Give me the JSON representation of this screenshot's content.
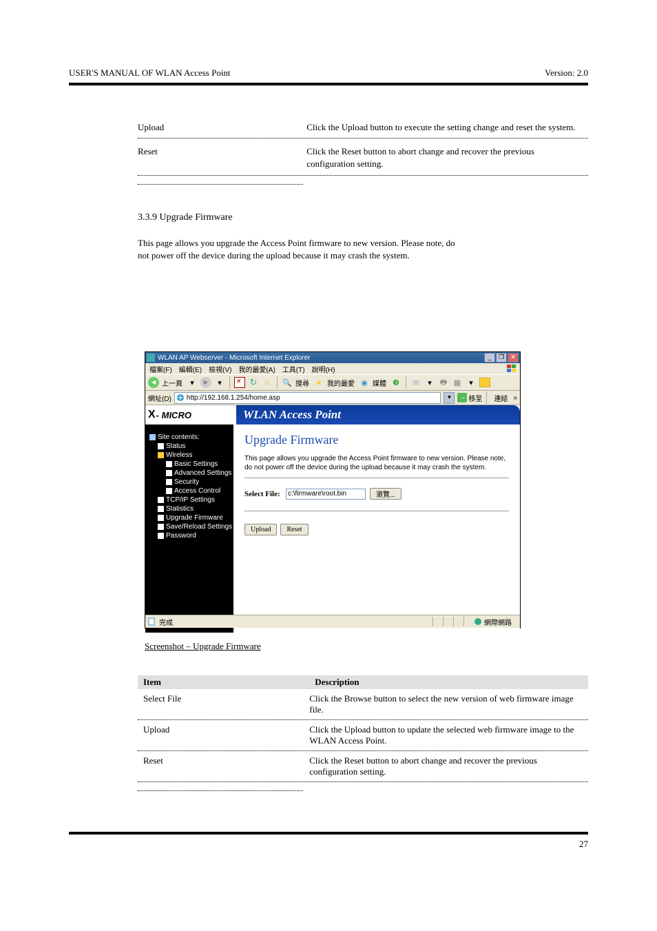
{
  "doc_header": "USER'S MANUAL OF WLAN Access Point",
  "version_lbl": "Version: 2.0",
  "top_rows": [
    {
      "item": "Upload",
      "desc": "Click the Upload button to execute the setting change and reset the system.",
      "lbl_w": 242,
      "desc_w": 400
    },
    {
      "item": "Reset",
      "desc": "Click the Reset button to abort change and recover the previous configuration setting.",
      "lbl_w": 242,
      "desc_w": 400
    }
  ],
  "section_heading": "3.3.9 Upgrade Firmware",
  "section_para": [
    "This page allows you upgrade the Access Point firmware to new version. Please note, do",
    "not power off the device during the upload because it may crash the system."
  ],
  "browser": {
    "title": "WLAN AP Webserver - Microsoft Internet Explorer",
    "menus": [
      "檔案(F)",
      "編輯(E)",
      "檢視(V)",
      "我的最愛(A)",
      "工具(T)",
      "說明(H)"
    ],
    "back": "上一頁",
    "search": "搜尋",
    "favorites": "我的最愛",
    "media": "媒體",
    "address_label": "網址(D)",
    "address_value": "http://192.168.1.254/home.asp",
    "go": "移至",
    "links": "連結",
    "chev": "»",
    "status_done": "完成",
    "status_net": "網際網路"
  },
  "brand": {
    "x": "X",
    "rest": "- MICRO"
  },
  "banner": "WLAN Access Point",
  "sidebar": {
    "root": "Site contents:",
    "items": [
      {
        "label": "Status",
        "cls": "indent1",
        "ico": "page-ico"
      },
      {
        "label": "Wireless",
        "cls": "indent1 wireless-link",
        "ico": "folder-ico"
      },
      {
        "label": "Basic Settings",
        "cls": "indent2",
        "ico": "page-ico"
      },
      {
        "label": "Advanced Settings",
        "cls": "indent2",
        "ico": "page-ico"
      },
      {
        "label": "Security",
        "cls": "indent2",
        "ico": "page-ico"
      },
      {
        "label": "Access Control",
        "cls": "indent2",
        "ico": "page-ico"
      },
      {
        "label": "TCP/IP Settings",
        "cls": "indent1",
        "ico": "page-ico"
      },
      {
        "label": "Statistics",
        "cls": "indent1",
        "ico": "page-ico"
      },
      {
        "label": "Upgrade Firmware",
        "cls": "indent1",
        "ico": "page-ico"
      },
      {
        "label": "Save/Reload Settings",
        "cls": "indent1",
        "ico": "page-ico"
      },
      {
        "label": "Password",
        "cls": "indent1",
        "ico": "page-ico"
      }
    ]
  },
  "content": {
    "title": "Upgrade Firmware",
    "desc": "This page allows you upgrade the Access Point firmware to new version. Please note, do not power off the device during the upload because it may crash the system.",
    "select_label": "Select File:",
    "file_value": "c:\\firmware\\root.bin",
    "browse": "瀏覽...",
    "upload": "Upload",
    "reset": "Reset"
  },
  "caption": "Screenshot – Upgrade Firmware",
  "table": {
    "head_item": "Item",
    "head_desc": "Description",
    "rows": [
      {
        "item": "Select File",
        "desc": "Click the Browse button to select the new version of web firmware image file.",
        "c1w": 242,
        "c2w": 400
      },
      {
        "item": "Upload",
        "desc": "Click the Upload button to update the selected web firmware image to the WLAN Access Point.",
        "c1w": 242,
        "c2w": 400
      },
      {
        "item": "Reset",
        "desc": "Click the Reset button to abort change and recover the previous configuration setting.",
        "c1w": 242,
        "c2w": 400
      }
    ]
  },
  "page_num": "27"
}
